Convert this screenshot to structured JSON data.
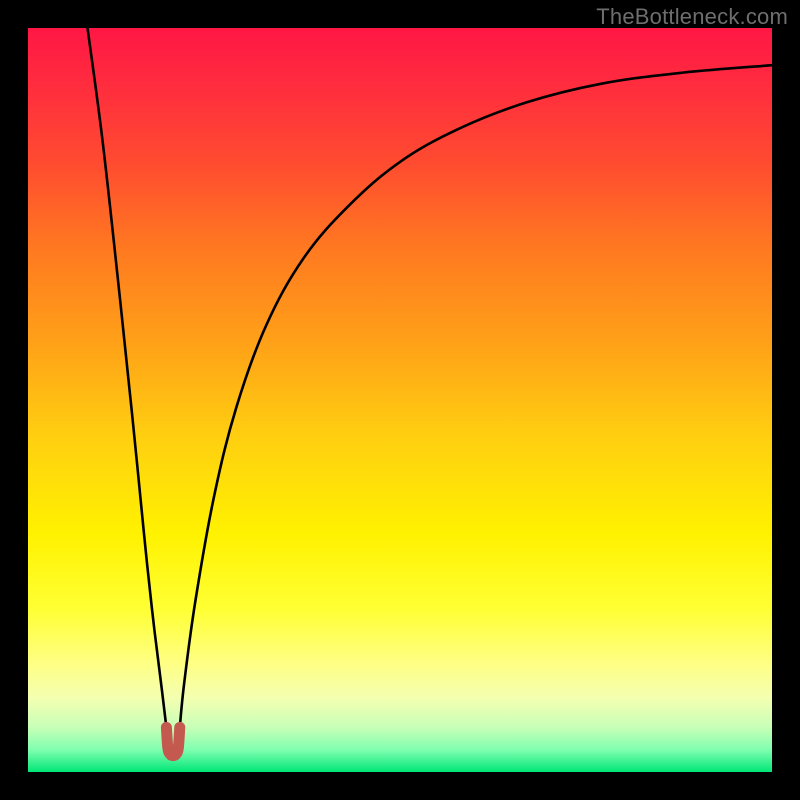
{
  "watermark": "TheBottleneck.com",
  "chart_data": {
    "type": "line",
    "title": "",
    "xlabel": "",
    "ylabel": "",
    "xlim": [
      0,
      100
    ],
    "ylim": [
      0,
      100
    ],
    "background_gradient": {
      "stops": [
        {
          "offset": 0.0,
          "color": "#ff1744"
        },
        {
          "offset": 0.07,
          "color": "#ff2a3f"
        },
        {
          "offset": 0.18,
          "color": "#ff4b30"
        },
        {
          "offset": 0.3,
          "color": "#ff7a20"
        },
        {
          "offset": 0.42,
          "color": "#ffa018"
        },
        {
          "offset": 0.55,
          "color": "#ffcf10"
        },
        {
          "offset": 0.68,
          "color": "#fff200"
        },
        {
          "offset": 0.78,
          "color": "#ffff33"
        },
        {
          "offset": 0.85,
          "color": "#ffff80"
        },
        {
          "offset": 0.9,
          "color": "#f4ffb0"
        },
        {
          "offset": 0.94,
          "color": "#c8ffb8"
        },
        {
          "offset": 0.97,
          "color": "#80ffb0"
        },
        {
          "offset": 1.0,
          "color": "#00e676"
        }
      ]
    },
    "series": [
      {
        "name": "left-arm",
        "stroke": "#000000",
        "width": 2.6,
        "points": [
          {
            "x": 8.0,
            "y": 100.0
          },
          {
            "x": 10.0,
            "y": 85.0
          },
          {
            "x": 12.0,
            "y": 67.0
          },
          {
            "x": 14.0,
            "y": 48.0
          },
          {
            "x": 15.0,
            "y": 38.0
          },
          {
            "x": 16.0,
            "y": 28.0
          },
          {
            "x": 17.0,
            "y": 19.0
          },
          {
            "x": 18.0,
            "y": 11.0
          },
          {
            "x": 18.6,
            "y": 6.0
          }
        ]
      },
      {
        "name": "right-arm",
        "stroke": "#000000",
        "width": 2.6,
        "points": [
          {
            "x": 20.4,
            "y": 6.0
          },
          {
            "x": 21.0,
            "y": 12.0
          },
          {
            "x": 22.5,
            "y": 23.0
          },
          {
            "x": 25.0,
            "y": 37.0
          },
          {
            "x": 28.0,
            "y": 49.0
          },
          {
            "x": 32.0,
            "y": 60.0
          },
          {
            "x": 37.0,
            "y": 69.0
          },
          {
            "x": 43.0,
            "y": 76.0
          },
          {
            "x": 50.0,
            "y": 82.0
          },
          {
            "x": 58.0,
            "y": 86.5
          },
          {
            "x": 67.0,
            "y": 90.0
          },
          {
            "x": 77.0,
            "y": 92.5
          },
          {
            "x": 88.0,
            "y": 94.0
          },
          {
            "x": 100.0,
            "y": 95.0
          }
        ]
      }
    ],
    "marker": {
      "name": "bottom-u-marker",
      "stroke": "#c45a4f",
      "width": 11,
      "points": [
        {
          "x": 18.6,
          "y": 6.0
        },
        {
          "x": 18.8,
          "y": 3.2
        },
        {
          "x": 19.1,
          "y": 2.4
        },
        {
          "x": 19.5,
          "y": 2.2
        },
        {
          "x": 19.9,
          "y": 2.4
        },
        {
          "x": 20.2,
          "y": 3.2
        },
        {
          "x": 20.4,
          "y": 6.0
        }
      ]
    }
  }
}
